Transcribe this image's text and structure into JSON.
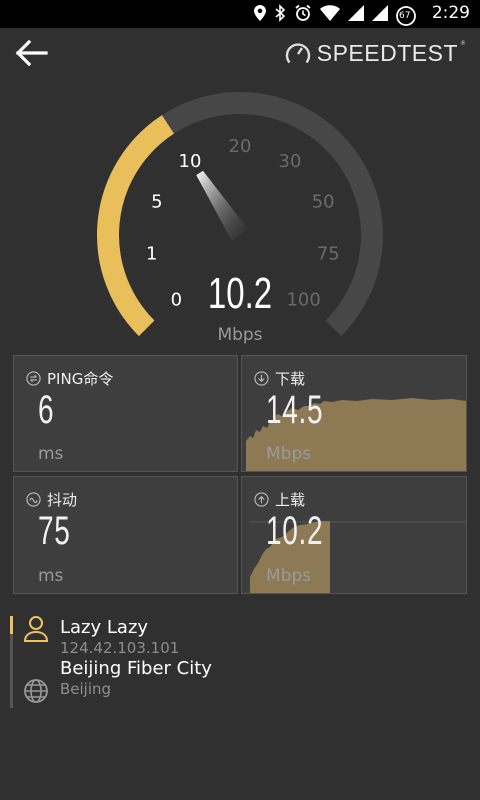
{
  "status_bar": {
    "time": "2:29",
    "battery_level": "67"
  },
  "header": {
    "brand": "SPEEDTEST"
  },
  "gauge": {
    "value": "10.2",
    "unit": "Mbps",
    "ticks": [
      "0",
      "1",
      "5",
      "10",
      "20",
      "30",
      "50",
      "75",
      "100"
    ],
    "fill_level_mbps": 10.2,
    "accent_color": "#E9BF5C"
  },
  "ping": {
    "label": "PING命令",
    "value": "6",
    "unit": "ms"
  },
  "download": {
    "label": "下载",
    "value": "14.5",
    "unit": "Mbps"
  },
  "jitter": {
    "label": "抖动",
    "value": "75",
    "unit": "ms"
  },
  "upload": {
    "label": "上载",
    "value": "10.2",
    "unit": "Mbps"
  },
  "server": {
    "user_name": "Lazy Lazy",
    "ip": "124.42.103.101",
    "isp": "Beijing Fiber City",
    "location": "Beijing"
  }
}
